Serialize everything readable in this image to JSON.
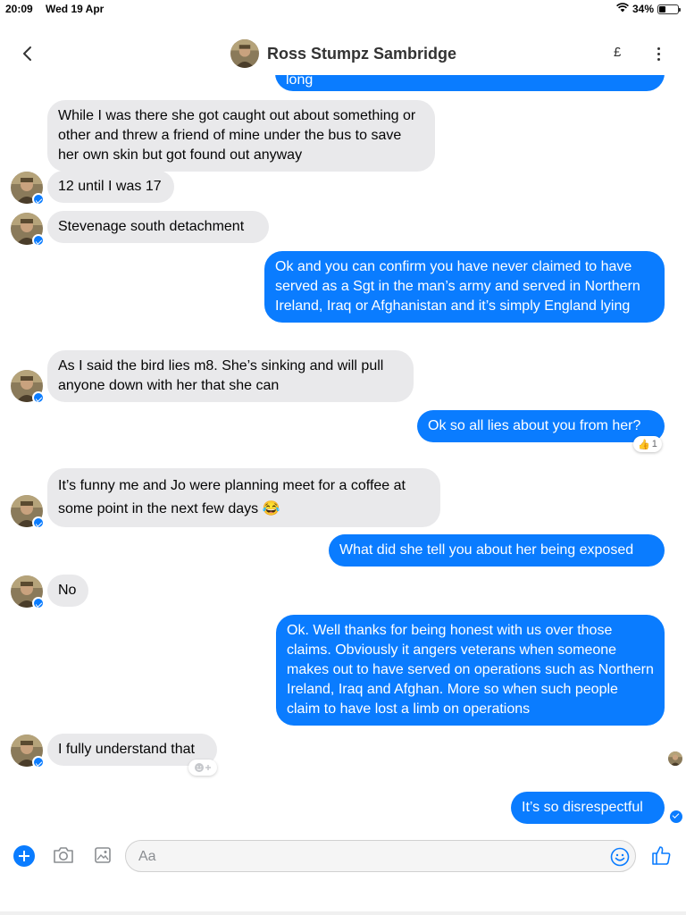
{
  "status_bar": {
    "time": "20:09",
    "date": "Wed 19 Apr",
    "battery": "34%",
    "battery_level": 0.34
  },
  "header": {
    "contact_name": "Ross Stumpz Sambridge",
    "currency_label": "£"
  },
  "messages": [
    {
      "direction": "out",
      "text": "long"
    },
    {
      "direction": "in",
      "text": "While I was there she got caught out about something or other and threw a friend of mine under the bus to save her own skin but got found out anyway"
    },
    {
      "direction": "in",
      "text": "12 until I was 17"
    },
    {
      "direction": "in",
      "text": "Stevenage south detachment"
    },
    {
      "direction": "out",
      "text": "Ok and you can confirm you have never claimed to have served as a Sgt in the man’s army and served in Northern Ireland, Iraq or Afghanistan and it’s simply England lying"
    },
    {
      "direction": "in",
      "text": "As I said the bird lies m8. She’s sinking and will pull anyone down with her that she can"
    },
    {
      "direction": "out",
      "text": "Ok so all lies about you from her?"
    },
    {
      "direction": "in",
      "text": "It’s funny me and Jo were planning meet for a coffee at some point in the next few days 😂"
    },
    {
      "direction": "out",
      "text": "What did she tell you about her being exposed"
    },
    {
      "direction": "in",
      "text": "No"
    },
    {
      "direction": "out",
      "text": "Ok. Well thanks for being honest with us over those claims. Obviously it angers veterans when someone makes out to have served on operations such as Northern Ireland, Iraq and Afghan. More so when such people claim to have lost a limb on operations"
    },
    {
      "direction": "in",
      "text": "I fully understand that"
    },
    {
      "direction": "out",
      "text": "It’s so disrespectful"
    }
  ],
  "reaction": {
    "emoji": "👍",
    "count": "1"
  },
  "composer": {
    "placeholder": "Aa"
  },
  "colors": {
    "accent": "#0a7cff",
    "incoming_bubble": "#e9e9eb",
    "outgoing_text": "#ffffff"
  },
  "icons": [
    "back-chevron-icon",
    "more-vertical-icon",
    "plus-icon",
    "camera-icon",
    "image-icon",
    "emoji-icon",
    "thumbs-up-icon",
    "messenger-badge-icon",
    "add-reaction-icon",
    "sent-check-icon"
  ]
}
